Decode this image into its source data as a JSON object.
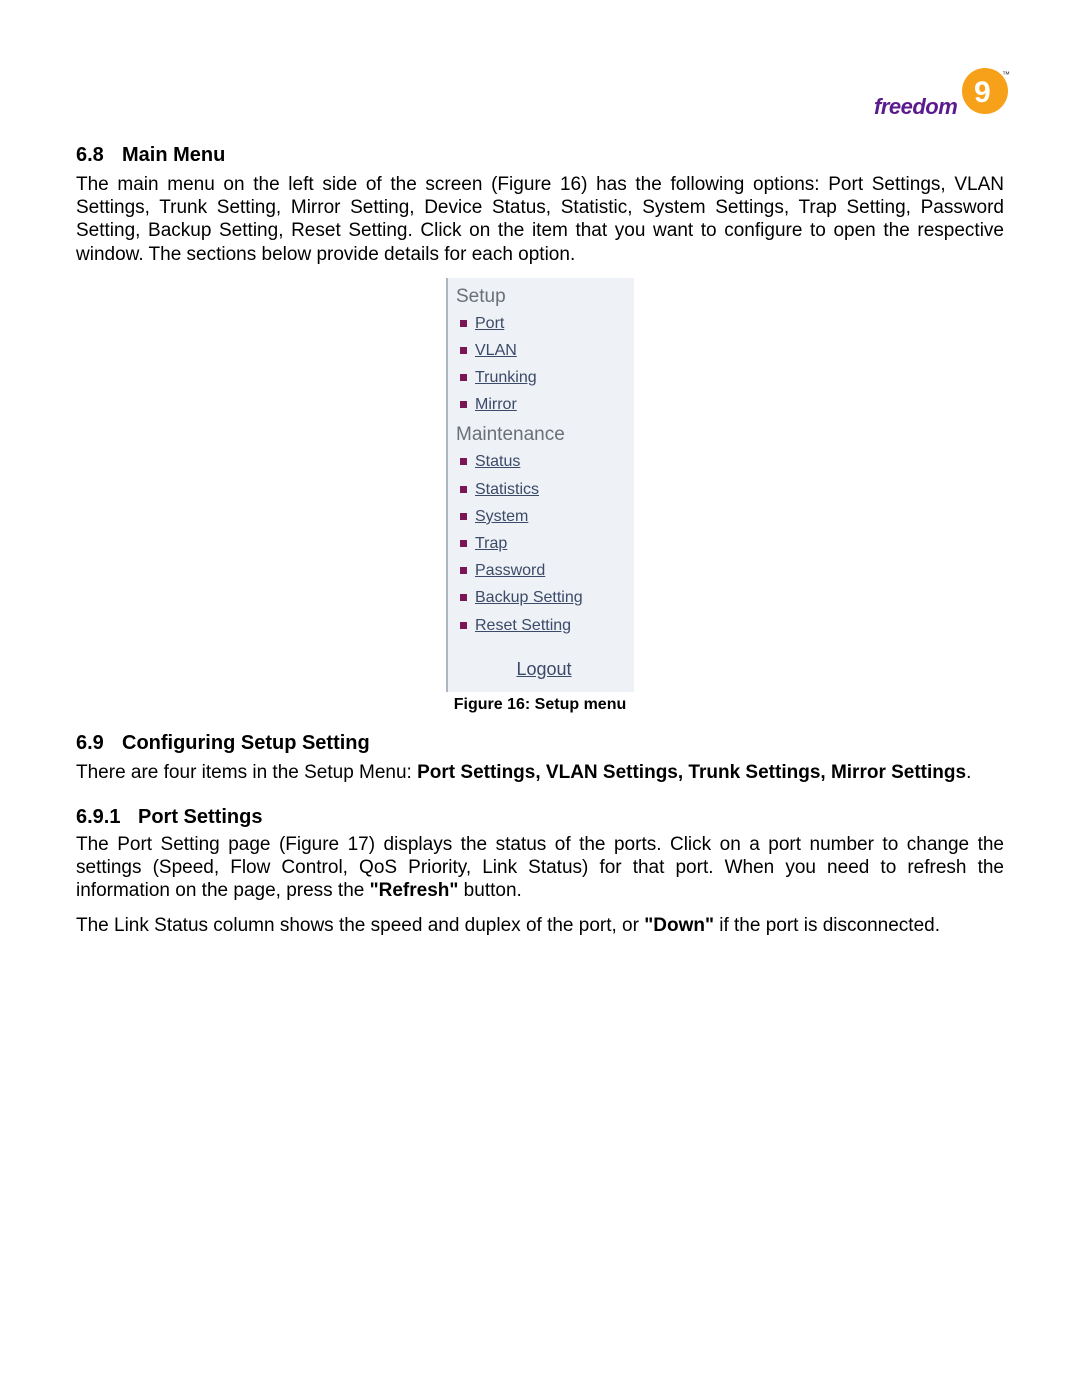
{
  "logo": {
    "brand_text": "freedom",
    "nine": "9",
    "tm": "™"
  },
  "sections": {
    "s68": {
      "num": "6.8",
      "title": "Main Menu",
      "para": "The main menu on the left side of the screen (Figure 16) has the following options: Port Settings, VLAN Settings, Trunk Setting, Mirror Setting, Device Status, Statistic, System Settings, Trap Setting, Password Setting, Backup Setting, Reset Setting.  Click on the item that you want to configure to open the respective window.  The sections below provide details for each option."
    },
    "s69": {
      "num": "6.9",
      "title": "Configuring Setup Setting",
      "para_pre": "There are four items in the Setup Menu: ",
      "para_bold": "Port Settings, VLAN Settings, Trunk Settings, Mirror Settings",
      "para_post": "."
    },
    "s691": {
      "num": "6.9.1",
      "title": "Port Settings",
      "p1_pre": "The Port Setting page (Figure 17) displays the status of the ports.  Click on a port number to change the settings (Speed, Flow Control, QoS Priority, Link Status) for that port. When you need to refresh the information on the page, press the ",
      "p1_bold": "\"Refresh\"",
      "p1_post": " button.",
      "p2_pre": "The Link Status column shows the speed and duplex of the port, or ",
      "p2_bold": "\"Down\"",
      "p2_post": " if the port is disconnected."
    }
  },
  "figure16": {
    "caption": "Figure 16: Setup menu",
    "setup_header": "Setup",
    "maint_header": "Maintenance",
    "setup_items": [
      "Port",
      "VLAN",
      "Trunking",
      "Mirror"
    ],
    "maint_items": [
      "Status",
      "Statistics",
      "System",
      "Trap",
      "Password",
      "Backup Setting",
      "Reset Setting"
    ],
    "logout": "Logout"
  }
}
